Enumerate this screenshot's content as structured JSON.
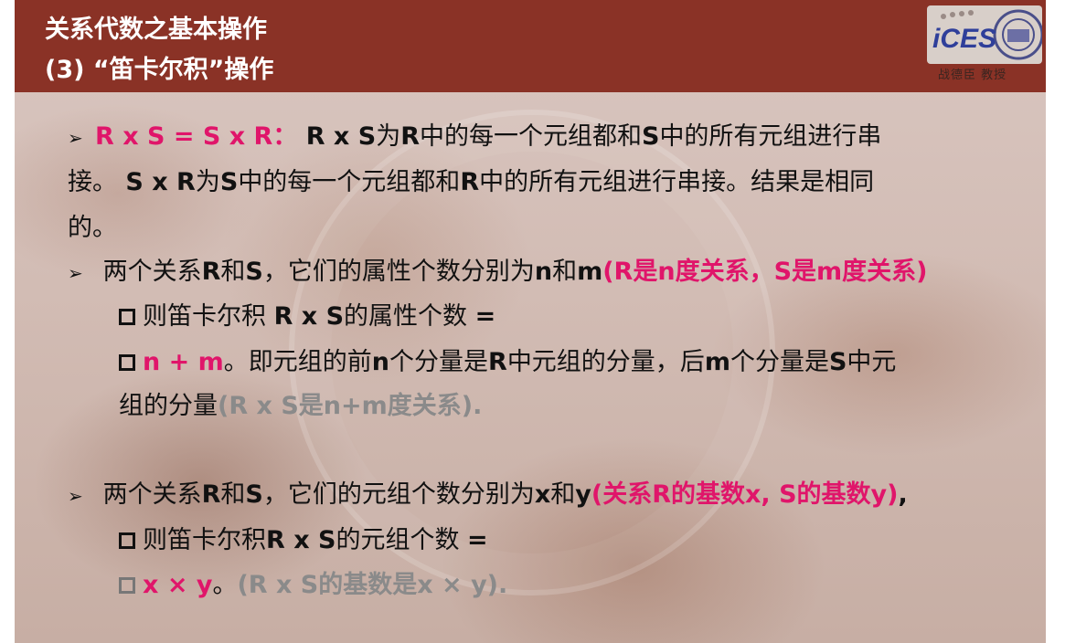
{
  "header": {
    "title": "关系代数之基本操作",
    "subtitle": "(3) “笛卡尔积”操作",
    "logo_text": "iCES",
    "logo_caption": "战德臣 教授"
  },
  "colors": {
    "header_bg": "#8a3226",
    "accent": "#e0156a",
    "muted": "#8a8a8a"
  },
  "points": {
    "p1": {
      "marker": "➢",
      "a": "R x S = S x R",
      "b": "：",
      "c": " R x S",
      "d": "为",
      "e": "R",
      "f": "中的每一个元组都和",
      "g": "S",
      "h": "中的所有元组进行串",
      "l2a": "接。",
      "l2b": " S x R",
      "l2c": "为",
      "l2d": "S",
      "l2e": "中的每一个元组都和",
      "l2f": "R",
      "l2g": "中的所有元组进行串接。结果是相同",
      "l3": "的。"
    },
    "p2": {
      "marker": "➢",
      "a": " 两个关系",
      "b": "R",
      "c": "和",
      "d": "S",
      "e": "，它们的属性个数分别为",
      "f": "n",
      "g": "和",
      "h": "m",
      "i": "(R是n度关系，S是m度关系)",
      "sub1_a": "则笛卡尔积 ",
      "sub1_b": "R x S",
      "sub1_c": "的属性个数 ",
      "sub1_d": "=",
      "sub2_a": "n + m",
      "sub2_b": "。即元组的前",
      "sub2_c": "n",
      "sub2_d": "个分量是",
      "sub2_e": "R",
      "sub2_f": "中元组的分量，后",
      "sub2_g": "m",
      "sub2_h": "个分量是",
      "sub2_i": "S",
      "sub2_j": "中元",
      "sub3_a": "组的分量",
      "sub3_b": "(R x S是n+m度关系)."
    },
    "p3": {
      "marker": "➢",
      "a": " 两个关系",
      "b": "R",
      "c": "和",
      "d": "S",
      "e": "，它们的元组个数分别为",
      "f": "x",
      "g": "和",
      "h": "y",
      "i": "(关系R的基数x, S的基数y)",
      "j": ",",
      "sub1_a": "则笛卡尔积",
      "sub1_b": "R x S",
      "sub1_c": "的元组个数 ",
      "sub1_d": "=",
      "sub2_a": "x × y",
      "sub2_b": "。",
      "sub2_c": "(R x S的基数是x × y)."
    }
  }
}
